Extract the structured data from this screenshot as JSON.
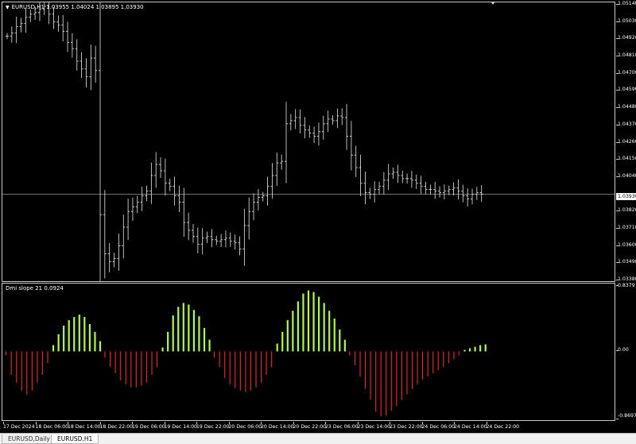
{
  "main_chart": {
    "title": "EURUSD,H1  1.03955 1.04024 1.03895 1.03930",
    "price_labels": [
      "1.05140",
      "1.05030",
      "1.04920",
      "1.04810",
      "1.04700",
      "1.04590",
      "1.04480",
      "1.04370",
      "1.04260",
      "1.04150",
      "1.04040",
      "1.03820",
      "1.03710",
      "1.03600",
      "1.03490",
      "1.03380"
    ],
    "current_price": "1.03930"
  },
  "indicator": {
    "title": "Dmi slope 21 0.0924",
    "scale_labels": [
      "0.8379",
      "0.00",
      "-0.8697"
    ],
    "colors": {
      "positive": "#adff2f",
      "negative": "#e0241b"
    }
  },
  "time_labels": [
    "17 Dec 2024",
    "18 Dec 06:00",
    "18 Dec 14:00",
    "18 Dec 22:00",
    "19 Dec 06:00",
    "19 Dec 14:00",
    "19 Dec 22:00",
    "20 Dec 06:00",
    "20 Dec 14:00",
    "20 Dec 22:00",
    "23 Dec 06:00",
    "23 Dec 14:00",
    "23 Dec 22:00",
    "24 Dec 06:00",
    "24 Dec 14:00",
    "24 Dec 22:00"
  ],
  "tabs": [
    {
      "label": "EURUSD,Daily",
      "active": false
    },
    {
      "label": "EURUSD,H1",
      "active": true
    }
  ],
  "chart_data": {
    "type": "bar",
    "series": [
      {
        "name": "EURUSD,H1",
        "kind": "ohlc",
        "close": [
          1.0494,
          1.0496,
          1.05,
          1.0502,
          1.0506,
          1.0508,
          1.0509,
          1.0511,
          1.0513,
          1.0508,
          1.0503,
          1.0501,
          1.0497,
          1.049,
          1.0486,
          1.0478,
          1.0473,
          1.0468,
          1.048,
          1.0472,
          1.038,
          1.0355,
          1.035,
          1.0352,
          1.036,
          1.0372,
          1.0382,
          1.0385,
          1.0388,
          1.0392,
          1.0395,
          1.0405,
          1.0412,
          1.0408,
          1.04,
          1.0398,
          1.0392,
          1.0388,
          1.0375,
          1.037,
          1.0366,
          1.0361,
          1.0365,
          1.0366,
          1.0364,
          1.0363,
          1.0364,
          1.0365,
          1.0363,
          1.0362,
          1.0358,
          1.0373,
          1.0382,
          1.0388,
          1.0391,
          1.0392,
          1.0398,
          1.0405,
          1.0413,
          1.0414,
          1.0438,
          1.044,
          1.0442,
          1.0437,
          1.0434,
          1.0432,
          1.043,
          1.0433,
          1.0438,
          1.0441,
          1.044,
          1.0443,
          1.0442,
          1.043,
          1.0418,
          1.041,
          1.04,
          1.0394,
          1.0393,
          1.0396,
          1.0398,
          1.0402,
          1.0406,
          1.0407,
          1.0405,
          1.0403,
          1.0403,
          1.0402,
          1.04,
          1.0398,
          1.0396,
          1.0396,
          1.0395,
          1.0394,
          1.0395,
          1.0396,
          1.0397,
          1.0395,
          1.0392,
          1.039,
          1.0393,
          1.0394,
          1.0393
        ]
      },
      {
        "name": "Dmi slope 21",
        "kind": "histogram",
        "values": [
          -0.05,
          -0.3,
          -0.4,
          -0.5,
          -0.55,
          -0.5,
          -0.4,
          -0.3,
          -0.15,
          0.08,
          0.22,
          0.33,
          0.4,
          0.44,
          0.47,
          0.44,
          0.35,
          0.25,
          0.13,
          -0.08,
          -0.2,
          -0.28,
          -0.37,
          -0.42,
          -0.46,
          -0.46,
          -0.44,
          -0.4,
          -0.3,
          -0.2,
          0.05,
          0.25,
          0.46,
          0.57,
          0.62,
          0.6,
          0.53,
          0.45,
          0.3,
          0.15,
          -0.08,
          -0.2,
          -0.34,
          -0.42,
          -0.47,
          -0.5,
          -0.52,
          -0.5,
          -0.46,
          -0.4,
          -0.3,
          -0.2,
          0.1,
          0.25,
          0.4,
          0.52,
          0.64,
          0.74,
          0.78,
          0.76,
          0.7,
          0.62,
          0.52,
          0.42,
          0.28,
          0.15,
          -0.05,
          -0.18,
          -0.32,
          -0.48,
          -0.62,
          -0.77,
          -0.83,
          -0.82,
          -0.76,
          -0.7,
          -0.62,
          -0.55,
          -0.48,
          -0.42,
          -0.36,
          -0.32,
          -0.28,
          -0.24,
          -0.2,
          -0.15,
          -0.1,
          -0.05,
          0.02,
          0.04,
          0.06,
          0.08,
          0.09
        ]
      }
    ],
    "ylim": [
      1.0338,
      1.0514
    ],
    "indicator_ylim": [
      -0.8697,
      0.8379
    ],
    "grid": false
  }
}
